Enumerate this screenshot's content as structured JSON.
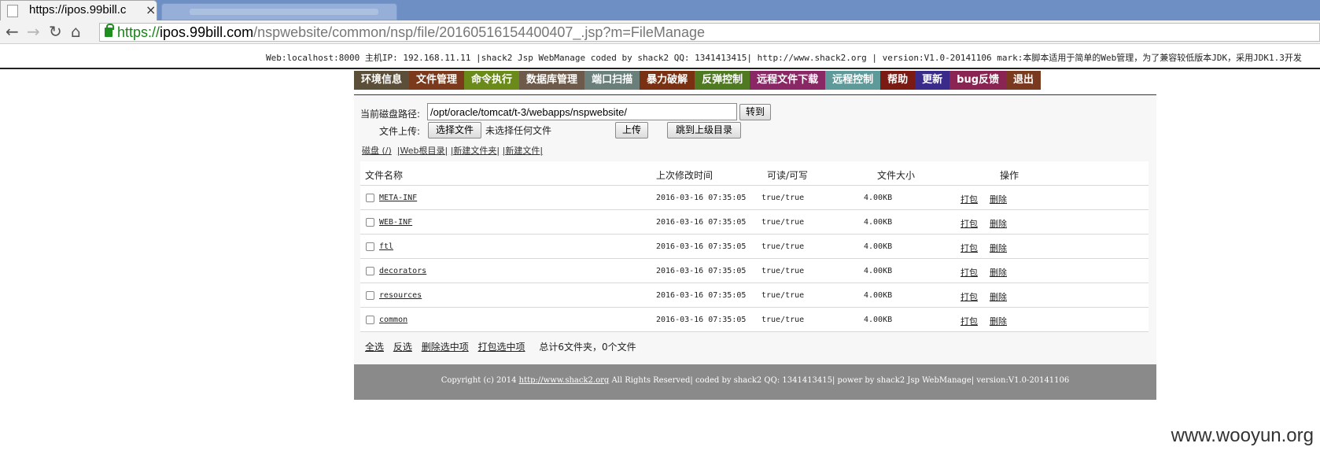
{
  "browser": {
    "tab_title": "https://ipos.99bill.c",
    "close_glyph": "×",
    "url_scheme": "https://",
    "url_host": "ipos.99bill.com",
    "url_path": "/nspwebsite/common/nsp/file/20160516154400407_.jsp?m=FileManage"
  },
  "infobar": {
    "text": "Web:localhost:8000 主机IP: 192.168.11.11 |shack2 Jsp WebManage coded by shack2 QQ: 1341413415| http://www.shack2.org | version:V1.0-20141106 mark:本脚本适用于简单的Web管理，为了兼容较低版本JDK，采用JDK1.3开发"
  },
  "menu": [
    {
      "label": "环境信息",
      "color": "#5c4f3a"
    },
    {
      "label": "文件管理",
      "color": "#7c3a1c"
    },
    {
      "label": "命令执行",
      "color": "#6a8a1a"
    },
    {
      "label": "数据库管理",
      "color": "#6e5a4a"
    },
    {
      "label": "端口扫描",
      "color": "#6a7f7a"
    },
    {
      "label": "暴力破解",
      "color": "#7a3012"
    },
    {
      "label": "反弹控制",
      "color": "#4f7a22"
    },
    {
      "label": "远程文件下载",
      "color": "#8a2866"
    },
    {
      "label": "远程控制",
      "color": "#5f9a9a"
    },
    {
      "label": "帮助",
      "color": "#7a1a12"
    },
    {
      "label": "更新",
      "color": "#3a2a8a"
    },
    {
      "label": "bug反馈",
      "color": "#8a2452"
    },
    {
      "label": "退出",
      "color": "#7a3a20"
    }
  ],
  "form": {
    "path_label": "当前磁盘路径:",
    "path_value": "/opt/oracle/tomcat/t-3/webapps/nspwebsite/",
    "goto_button": "转到",
    "upload_label": "文件上传:",
    "choose_button": "选择文件",
    "no_file_text": "未选择任何文件",
    "upload_button": "上传",
    "parent_button": "跳到上级目录"
  },
  "quick_links": [
    "磁盘 (/)",
    "|Web根目录|",
    "|新建文件夹|",
    "|新建文件|"
  ],
  "table": {
    "headers": [
      "文件名称",
      "上次修改时间",
      "可读/可写",
      "文件大小",
      "操作"
    ],
    "rows": [
      {
        "name": "META-INF",
        "mtime": "2016-03-16 07:35:05",
        "rw": "true/true",
        "size": "4.00KB"
      },
      {
        "name": "WEB-INF",
        "mtime": "2016-03-16 07:35:05",
        "rw": "true/true",
        "size": "4.00KB"
      },
      {
        "name": "ftl",
        "mtime": "2016-03-16 07:35:05",
        "rw": "true/true",
        "size": "4.00KB"
      },
      {
        "name": "decorators",
        "mtime": "2016-03-16 07:35:05",
        "rw": "true/true",
        "size": "4.00KB"
      },
      {
        "name": "resources",
        "mtime": "2016-03-16 07:35:05",
        "rw": "true/true",
        "size": "4.00KB"
      },
      {
        "name": "common",
        "mtime": "2016-03-16 07:35:05",
        "rw": "true/true",
        "size": "4.00KB"
      }
    ],
    "action_pack": "打包",
    "action_delete": "删除"
  },
  "bottom": {
    "select_all": "全选",
    "invert": "反选",
    "delete_selected": "删除选中项",
    "pack_selected": "打包选中项",
    "summary": "总计6文件夹，0个文件"
  },
  "footer": {
    "prefix": "Copyright (c) 2014 ",
    "link": "http://www.shack2.org",
    "suffix": " All Rights Reserved| coded by shack2 QQ: 1341413415| power by shack2 Jsp WebManage| version:V1.0-20141106"
  },
  "watermark": "www.wooyun.org"
}
